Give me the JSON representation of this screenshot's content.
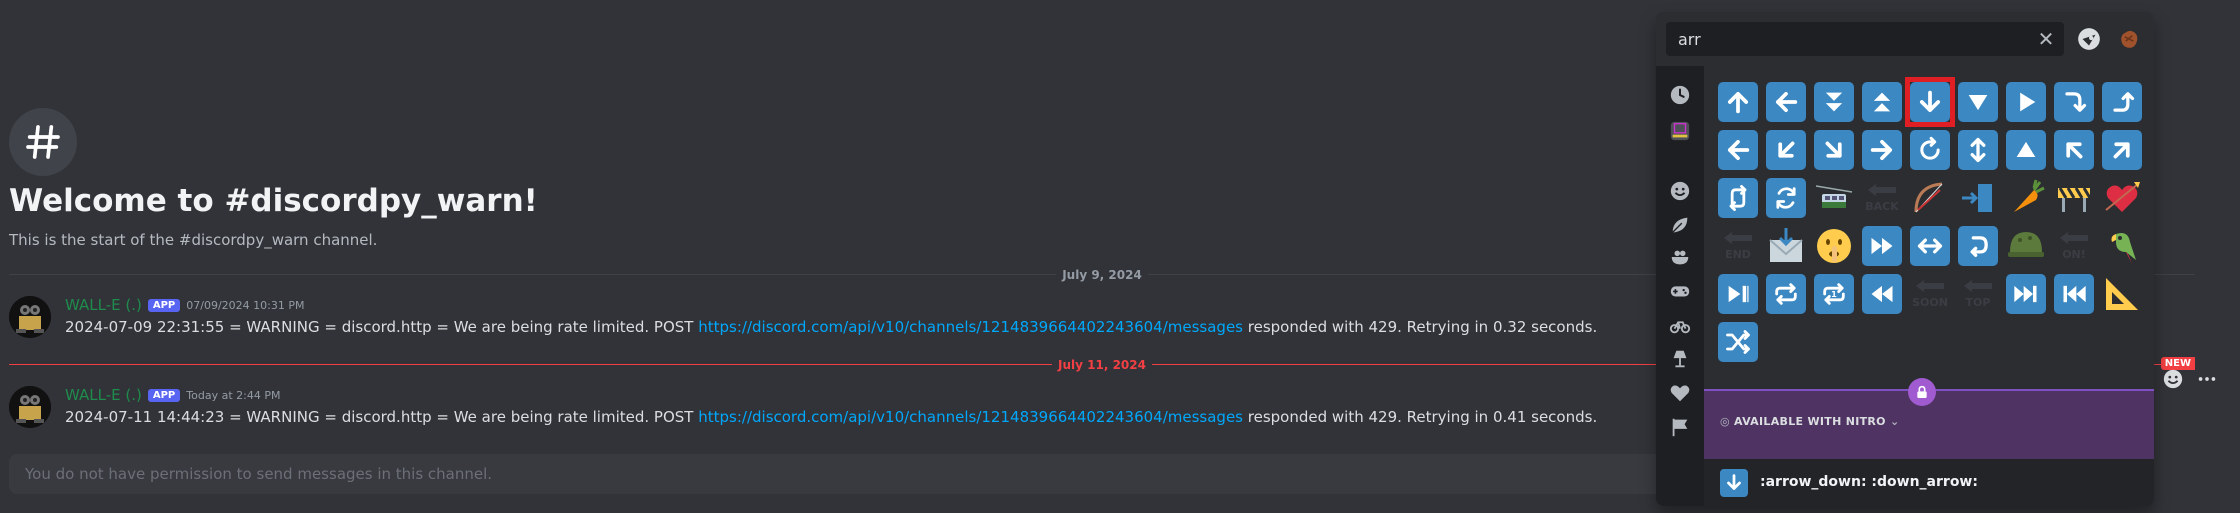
{
  "channel": {
    "welcome_title": "Welcome to #discordpy_warn!",
    "welcome_sub": "This is the start of the #discordpy_warn channel."
  },
  "dividers": {
    "first": "July 9, 2024",
    "second": "July 11, 2024",
    "new_tag": "NEW"
  },
  "messages": [
    {
      "author": "WALL-E (.)",
      "badge": "APP",
      "time": "07/09/2024 10:31 PM",
      "text_before": "2024-07-09 22:31:55 = WARNING = discord.http = We are being rate limited. POST ",
      "link": "https://discord.com/api/v10/channels/1214839664402243604/messages",
      "text_after": " responded with 429. Retrying in 0.32 seconds."
    },
    {
      "author": "WALL-E (.)",
      "badge": "APP",
      "time": "Today at 2:44 PM",
      "text_before": "2024-07-11 14:44:23 = WARNING = discord.http = We are being rate limited. POST ",
      "link": "https://discord.com/api/v10/channels/1214839664402243604/messages",
      "text_after": " responded with 429. Retrying in 0.41 seconds."
    }
  ],
  "composer": {
    "placeholder": "You do not have permission to send messages in this channel."
  },
  "picker": {
    "search_value": "arr",
    "nitro_label": "AVAILABLE WITH NITRO",
    "selected_names": ":arrow_down: :down_arrow:",
    "emojis": [
      [
        "arrow-up",
        "arrow-left",
        "double-down",
        "double-up",
        "arrow-down",
        "triangle-down",
        "play",
        "curve-down",
        "curve-up"
      ],
      [
        "arrow-left",
        "arrow-down-left",
        "arrow-down-right",
        "arrow-right",
        "curve-left",
        "up-down",
        "triangle-up",
        "arrow-up-left",
        "arrow-up-right"
      ],
      [
        "repeat-vertical",
        "refresh",
        "aerial-tramway",
        "back-arrow",
        "bow-and-arrow",
        "inbox-arrow",
        "carrot",
        "construction",
        "heart-arrow"
      ],
      [
        "end-arrow",
        "envelope-arrow",
        "shushing-face",
        "fast-forward",
        "left-right",
        "return-right",
        "military-helmet",
        "on-arrow",
        "parrot"
      ],
      [
        "next-track",
        "repeat",
        "repeat-one",
        "rewind",
        "soon-arrow",
        "top-arrow",
        "fast-next",
        "fast-prev",
        "triangular-ruler"
      ],
      [
        "shuffle"
      ]
    ]
  },
  "colors": {
    "keycap": "#3b88c3",
    "selection": "#e01f25",
    "link": "#00a8fc",
    "author": "#1f8b4c",
    "new": "#f23f43"
  }
}
